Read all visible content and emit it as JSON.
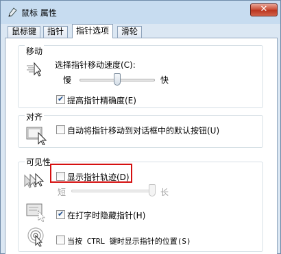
{
  "window": {
    "title": "鼠标 属性",
    "close_label": "✕"
  },
  "tabs": [
    {
      "label": "鼠标键",
      "active": false
    },
    {
      "label": "指针",
      "active": false
    },
    {
      "label": "指针选项",
      "active": true
    },
    {
      "label": "滑轮",
      "active": false
    }
  ],
  "motion": {
    "heading": "移动",
    "speed_label": "选择指针移动速度(C):",
    "slow_label": "慢",
    "fast_label": "快",
    "speed_level": 0.5,
    "precision_label": "提高指针精确度(E)",
    "precision_checked": true
  },
  "snap": {
    "heading": "对齐",
    "label": "自动将指针移动到对话框中的默认按钮(U)",
    "checked": false
  },
  "visibility": {
    "heading": "可见性",
    "trails_label": "显示指针轨迹(D)",
    "trails_checked": false,
    "short_label": "短",
    "long_label": "长",
    "trails_level": 1.0,
    "hide_label": "在打字时隐藏指针(H)",
    "hide_checked": true,
    "ctrl_label": "当按 CTRL 键时显示指针的位置(S)",
    "ctrl_checked": false
  }
}
